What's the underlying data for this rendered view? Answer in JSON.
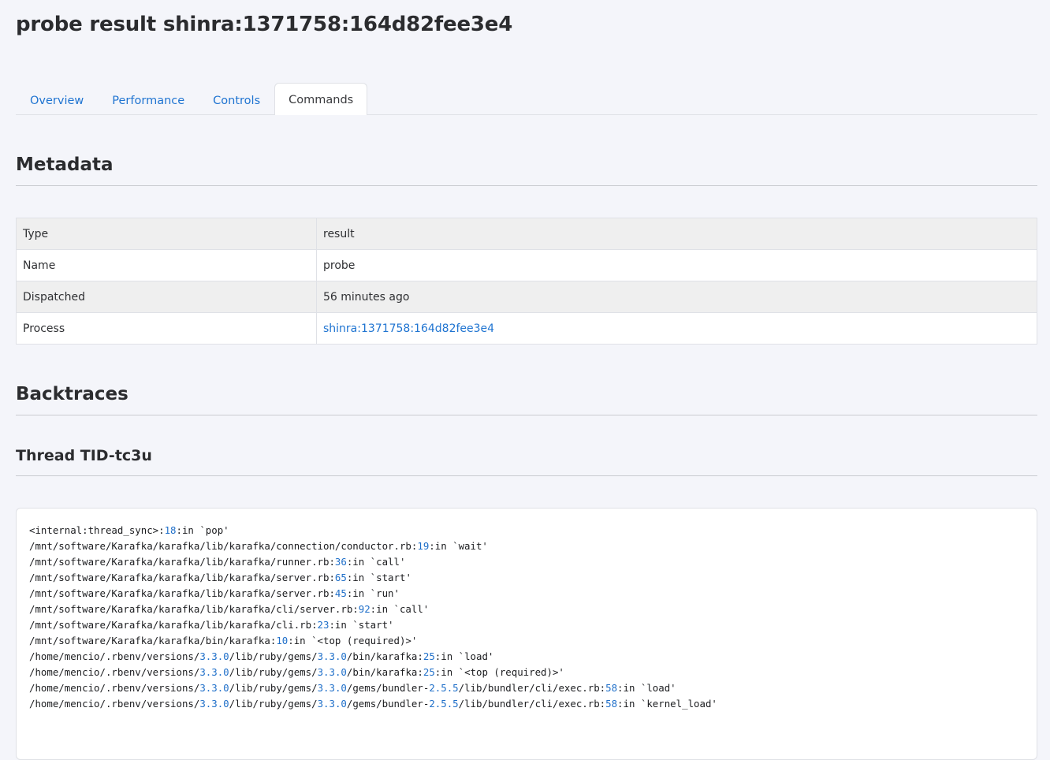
{
  "page": {
    "title": "probe result shinra:1371758:164d82fee3e4"
  },
  "tabs": [
    {
      "label": "Overview",
      "active": false
    },
    {
      "label": "Performance",
      "active": false
    },
    {
      "label": "Controls",
      "active": false
    },
    {
      "label": "Commands",
      "active": true
    }
  ],
  "metadata": {
    "heading": "Metadata",
    "rows": [
      {
        "key": "Type",
        "value": "result"
      },
      {
        "key": "Name",
        "value": "probe"
      },
      {
        "key": "Dispatched",
        "value": "56 minutes ago"
      },
      {
        "key": "Process",
        "value": "shinra:1371758:164d82fee3e4"
      }
    ]
  },
  "backtraces": {
    "heading": "Backtraces",
    "thread_title": "Thread TID-tc3u",
    "lines": [
      "<internal:thread_sync>:18:in `pop'",
      "/mnt/software/Karafka/karafka/lib/karafka/connection/conductor.rb:19:in `wait'",
      "/mnt/software/Karafka/karafka/lib/karafka/runner.rb:36:in `call'",
      "/mnt/software/Karafka/karafka/lib/karafka/server.rb:65:in `start'",
      "/mnt/software/Karafka/karafka/lib/karafka/server.rb:45:in `run'",
      "/mnt/software/Karafka/karafka/lib/karafka/cli/server.rb:92:in `call'",
      "/mnt/software/Karafka/karafka/lib/karafka/cli.rb:23:in `start'",
      "/mnt/software/Karafka/karafka/bin/karafka:10:in `<top (required)>'",
      "/home/mencio/.rbenv/versions/3.3.0/lib/ruby/gems/3.3.0/bin/karafka:25:in `load'",
      "/home/mencio/.rbenv/versions/3.3.0/lib/ruby/gems/3.3.0/bin/karafka:25:in `<top (required)>'",
      "/home/mencio/.rbenv/versions/3.3.0/lib/ruby/gems/3.3.0/gems/bundler-2.5.5/lib/bundler/cli/exec.rb:58:in `load'",
      "/home/mencio/.rbenv/versions/3.3.0/lib/ruby/gems/3.3.0/gems/bundler-2.5.5/lib/bundler/cli/exec.rb:58:in `kernel_load'"
    ]
  }
}
